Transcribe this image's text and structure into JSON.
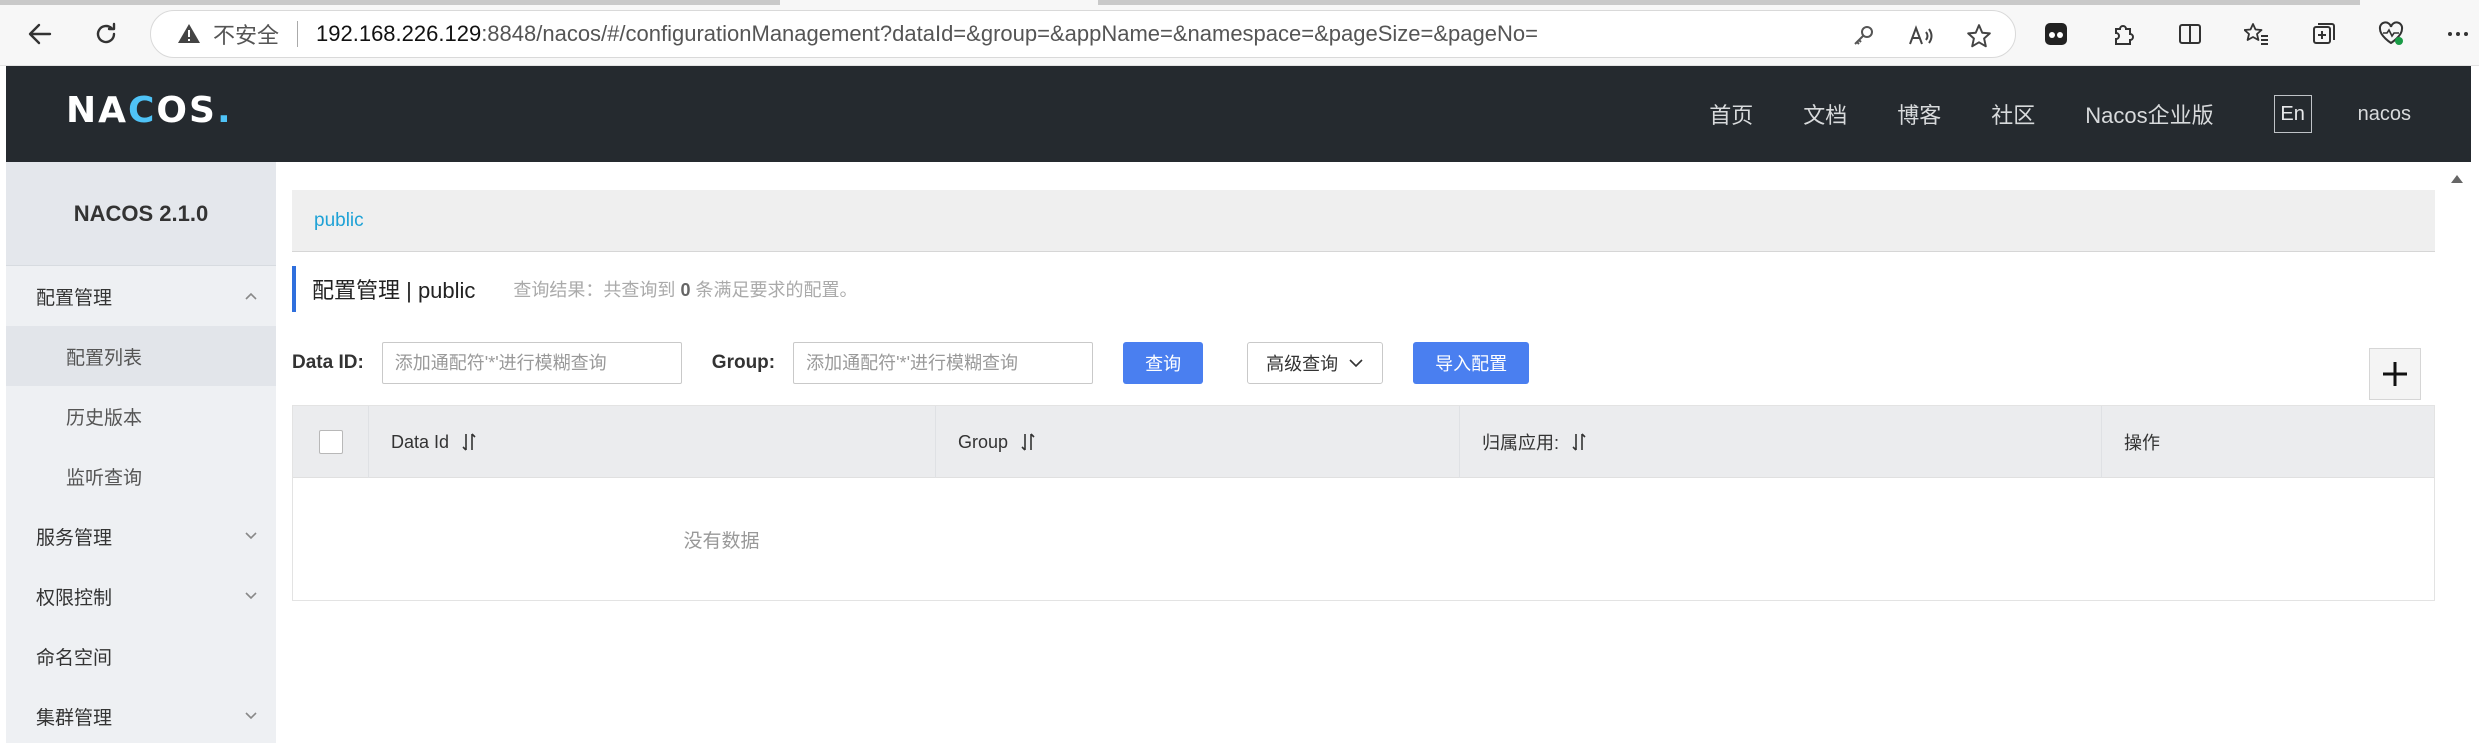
{
  "browser": {
    "insecure_label": "不安全",
    "url_host": "192.168.226.129",
    "url_rest": ":8848/nacos/#/configurationManagement?dataId=&group=&appName=&namespace=&pageSize=&pageNo="
  },
  "header": {
    "logo": {
      "pre": "NA",
      "o": "C",
      "post": "OS",
      "dot": "."
    },
    "nav": [
      "首页",
      "文档",
      "博客",
      "社区",
      "Nacos企业版"
    ],
    "lang": "En",
    "user": "nacos"
  },
  "sidebar": {
    "title": "NACOS 2.1.0",
    "items": [
      {
        "label": "配置管理"
      },
      {
        "label": "配置列表"
      },
      {
        "label": "历史版本"
      },
      {
        "label": "监听查询"
      },
      {
        "label": "服务管理"
      },
      {
        "label": "权限控制"
      },
      {
        "label": "命名空间"
      },
      {
        "label": "集群管理"
      }
    ]
  },
  "main": {
    "namespace_link": "public",
    "title": "配置管理 | public",
    "result_prefix": "查询结果：共查询到",
    "result_count": "0",
    "result_suffix": "条满足要求的配置。",
    "filters": {
      "dataid_label": "Data ID:",
      "dataid_placeholder": "添加通配符'*'进行模糊查询",
      "group_label": "Group:",
      "group_placeholder": "添加通配符'*'进行模糊查询",
      "query_btn": "查询",
      "advanced_btn": "高级查询",
      "import_btn": "导入配置"
    },
    "table": {
      "columns": [
        "Data Id",
        "Group",
        "归属应用:",
        "操作"
      ],
      "empty_text": "没有数据"
    }
  },
  "colors": {
    "header_bg": "#252a2f",
    "primary": "#4a7ff0",
    "link": "#1fa2d6",
    "accent_bar": "#2f6fdd"
  }
}
